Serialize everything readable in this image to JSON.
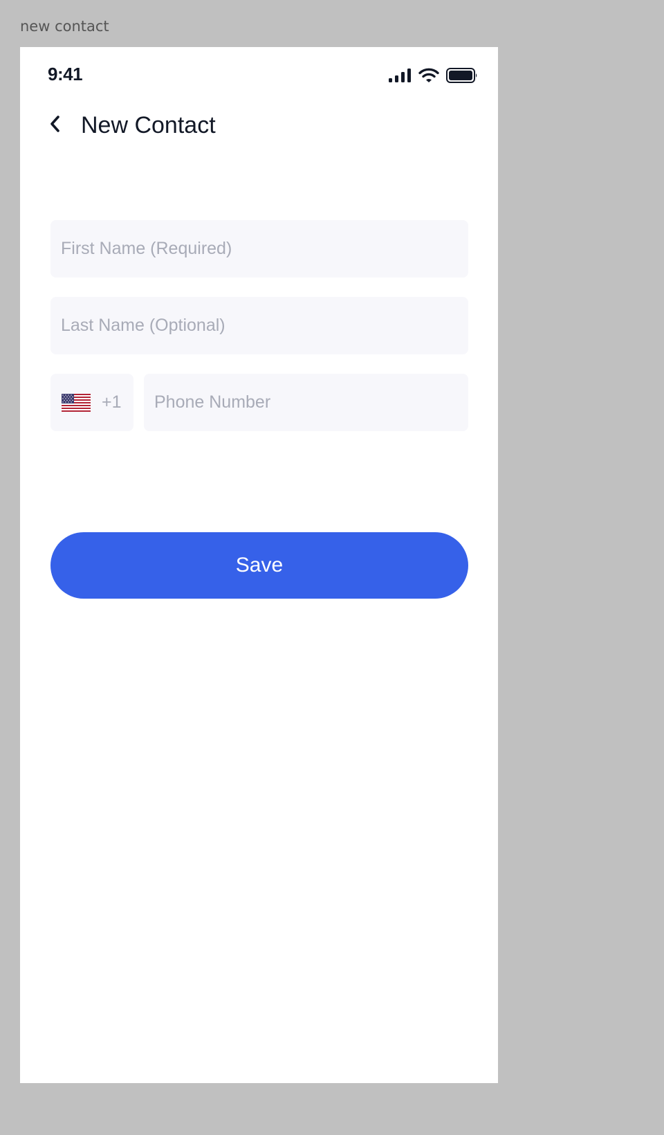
{
  "frame": {
    "label": "new contact"
  },
  "status_bar": {
    "time": "9:41",
    "icons": [
      "signal-icon",
      "wifi-icon",
      "battery-icon"
    ]
  },
  "header": {
    "back_icon": "chevron-left-icon",
    "title": "New Contact"
  },
  "form": {
    "first_name": {
      "value": "",
      "placeholder": "First Name (Required)"
    },
    "last_name": {
      "value": "",
      "placeholder": "Last Name (Optional)"
    },
    "country": {
      "flag_icon": "us-flag-icon",
      "code": "+1"
    },
    "phone": {
      "value": "",
      "placeholder": "Phone Number"
    },
    "save_label": "Save"
  },
  "colors": {
    "background": "#c0c0c0",
    "screen": "#ffffff",
    "text_primary": "#121826",
    "placeholder": "#a8abb7",
    "field_bg": "#f7f7fb",
    "accent": "#3661e9"
  }
}
